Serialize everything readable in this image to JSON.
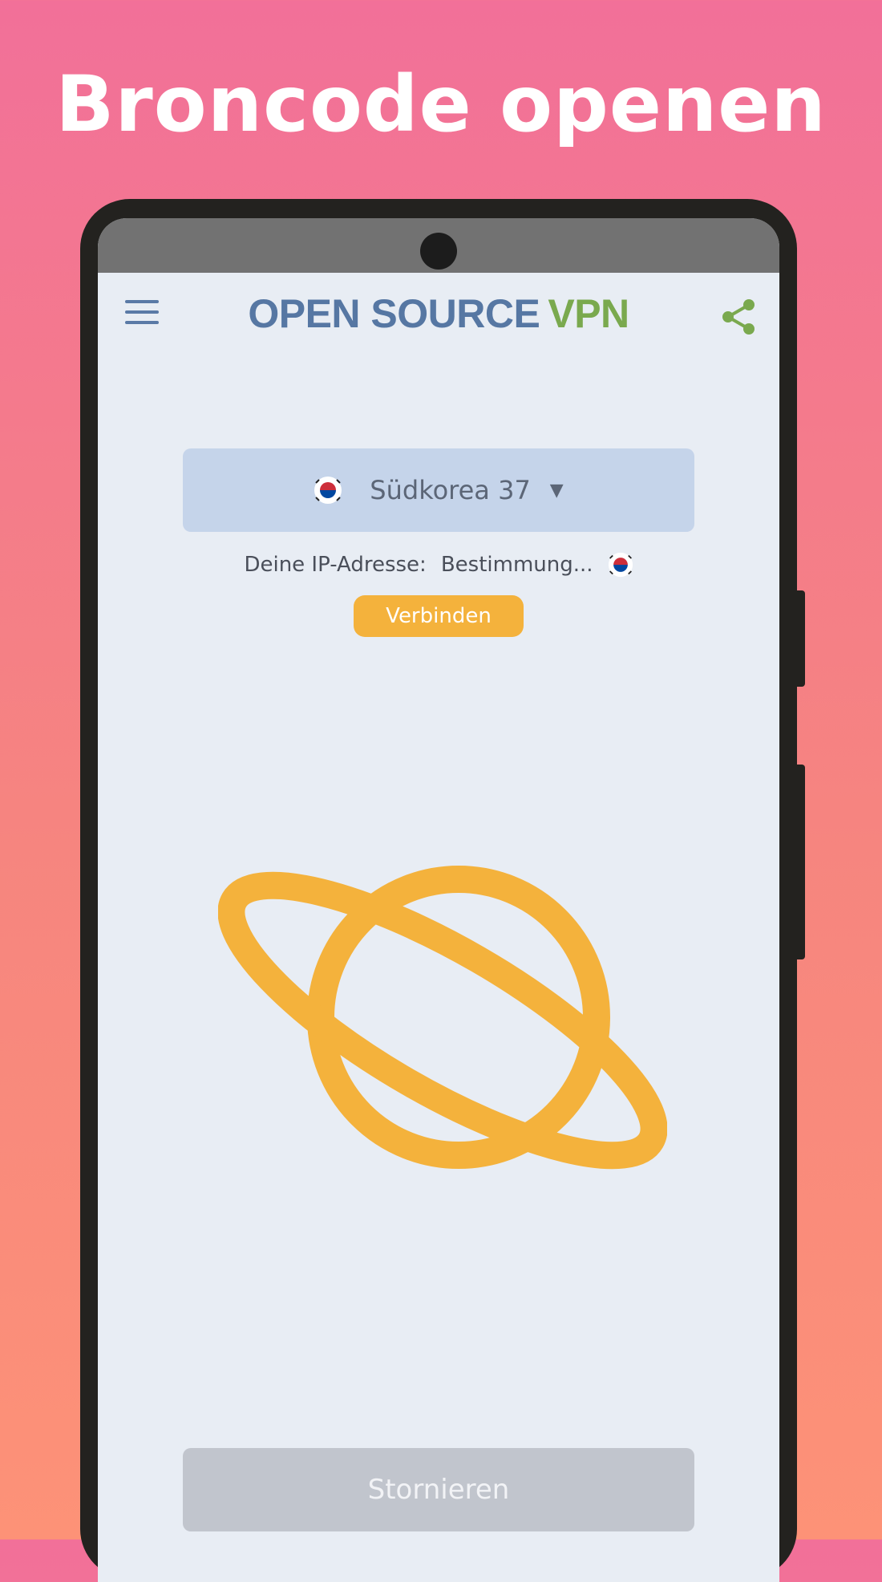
{
  "banner": {
    "headline": "Broncode openen"
  },
  "app": {
    "brand_part1": "OPEN SOURCE",
    "brand_part2": "VPN",
    "colors": {
      "brand_blue": "#5677a3",
      "brand_green": "#7aa94e",
      "accent": "#f4b23c"
    }
  },
  "toolbar": {
    "menu_icon": "hamburger-menu-icon",
    "share_icon": "share-icon"
  },
  "server": {
    "selected": "Südkorea 37",
    "flag_icon": "south-korea-flag-icon",
    "caret": "▼"
  },
  "status": {
    "ip_label": "Deine IP-Adresse:",
    "ip_value": "Bestimmung...",
    "flag_icon": "south-korea-flag-icon"
  },
  "actions": {
    "connect_label": "Verbinden",
    "cancel_label": "Stornieren"
  },
  "illustration": {
    "icon": "planet-icon"
  }
}
